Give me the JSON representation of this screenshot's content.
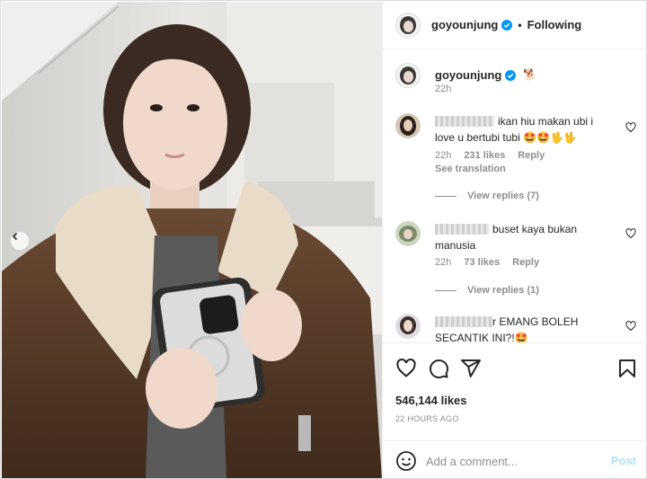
{
  "post": {
    "username": "goyounjung",
    "follow_status": "Following",
    "separator": "•",
    "caption": {
      "username": "goyounjung",
      "emoji": "🐕",
      "time": "22h"
    },
    "comments": [
      {
        "text": "ikan hiu makan ubi i love u bertubi tubi 🤩🤩🖖🖖",
        "time": "22h",
        "likes": "231 likes",
        "reply_label": "Reply",
        "see_translation": "See translation",
        "view_replies": "View replies (7)"
      },
      {
        "text": "buset kaya bukan manusia",
        "time": "22h",
        "likes": "73 likes",
        "reply_label": "Reply",
        "view_replies": "View replies (1)"
      },
      {
        "text_prefix": "r",
        "text": "EMANG BOLEH SECANTIK INI?!🤩"
      }
    ],
    "likes_count": "546,144 likes",
    "time_ago": "22 HOURS AGO",
    "add_comment_placeholder": "Add a comment...",
    "post_button": "Post"
  },
  "icons": {
    "verified": "verified-badge-icon",
    "heart": "heart-icon",
    "comment": "comment-icon",
    "share": "share-icon",
    "save": "bookmark-icon",
    "emoji": "emoji-icon",
    "carousel_prev": "chevron-left-icon"
  },
  "colors": {
    "verified": "#0095f6",
    "muted_text": "#8e8e8e",
    "post_disabled": "#b2dffc"
  }
}
